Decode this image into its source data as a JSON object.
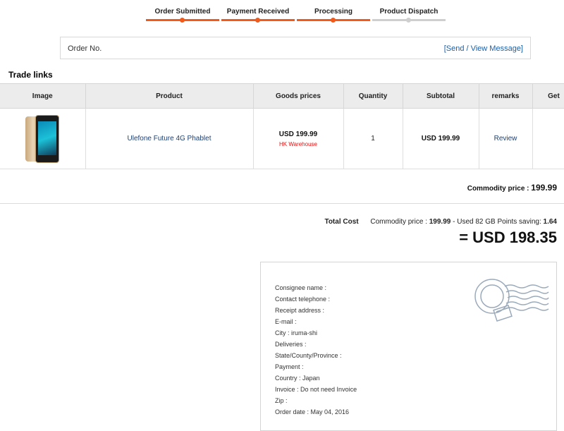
{
  "progress": {
    "steps": [
      {
        "label": "Order Submitted",
        "state": "done"
      },
      {
        "label": "Payment Received",
        "state": "done"
      },
      {
        "label": "Processing",
        "state": "done"
      },
      {
        "label": "Product Dispatch",
        "state": "todo"
      }
    ],
    "accent_color": "#f05a1a",
    "inactive_color": "#cfcfcf"
  },
  "order": {
    "number_label": "Order No.",
    "message_link": "[Send / View Message]"
  },
  "trade_links_title": "Trade links",
  "table": {
    "headers": [
      "Image",
      "Product",
      "Goods prices",
      "Quantity",
      "Subtotal",
      "remarks",
      "Get"
    ],
    "rows": [
      {
        "image_icon": "phone-product-image",
        "product": "Ulefone Future 4G Phablet",
        "price": "USD 199.99",
        "warehouse": "HK Warehouse",
        "quantity": "1",
        "subtotal": "USD 199.99",
        "remarks": "Review"
      }
    ]
  },
  "summary": {
    "commodity_label": "Commodity price :",
    "commodity_value": "199.99",
    "total_cost_label": "Total Cost",
    "total_commodity_label": "Commodity price :",
    "total_commodity_value": "199.99",
    "points_text": "- Used 82 GB Points saving:",
    "points_value": "1.64",
    "grand_total": "= USD 198.35"
  },
  "address": {
    "fields": [
      "Consignee name :",
      "Contact telephone :",
      "Receipt address :",
      "E-mail :",
      "City : iruma-shi",
      "Deliveries :",
      "State/County/Province :",
      "Payment :",
      "Country : Japan",
      "Invoice : Do not need Invoice",
      "Zip :",
      "Order date : May 04, 2016"
    ],
    "stamp_icon": "postmark-stamp-icon"
  }
}
